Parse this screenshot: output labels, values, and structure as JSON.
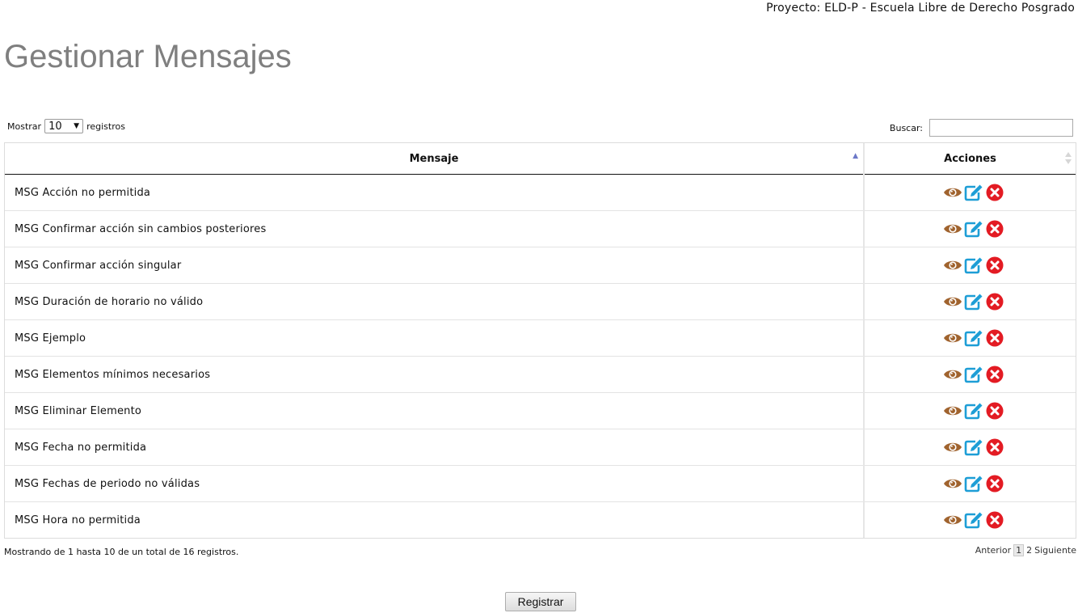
{
  "header": {
    "project": "Proyecto: ELD-P - Escuela Libre de Derecho Posgrado",
    "title": "Gestionar Mensajes"
  },
  "length_menu": {
    "prefix": "Mostrar",
    "selected": "10",
    "suffix": "registros"
  },
  "search": {
    "label": "Buscar:",
    "value": ""
  },
  "table": {
    "columns": [
      "Mensaje",
      "Acciones"
    ],
    "rows": [
      "MSG Acción no permitida",
      "MSG Confirmar acción sin cambios posteriores",
      "MSG Confirmar acción singular",
      "MSG Duración de horario no válido",
      "MSG Ejemplo",
      "MSG Elementos mínimos necesarios",
      "MSG Eliminar Elemento",
      "MSG Fecha no permitida",
      "MSG Fechas de periodo no válidas",
      "MSG Hora no permitida"
    ],
    "action_icons": [
      "eye-icon",
      "edit-icon",
      "delete-icon"
    ]
  },
  "footer": {
    "info": "Mostrando de 1 hasta 10 de un total de 16 registros.",
    "prev": "Anterior",
    "pages": [
      "1",
      "2"
    ],
    "next": "Siguiente"
  },
  "register_button": "Registrar",
  "colors": {
    "view": "#a0632e",
    "edit": "#1e9ed6",
    "delete": "#e31b23",
    "title": "#7f7f7f",
    "sort_active": "#6c78c8"
  }
}
